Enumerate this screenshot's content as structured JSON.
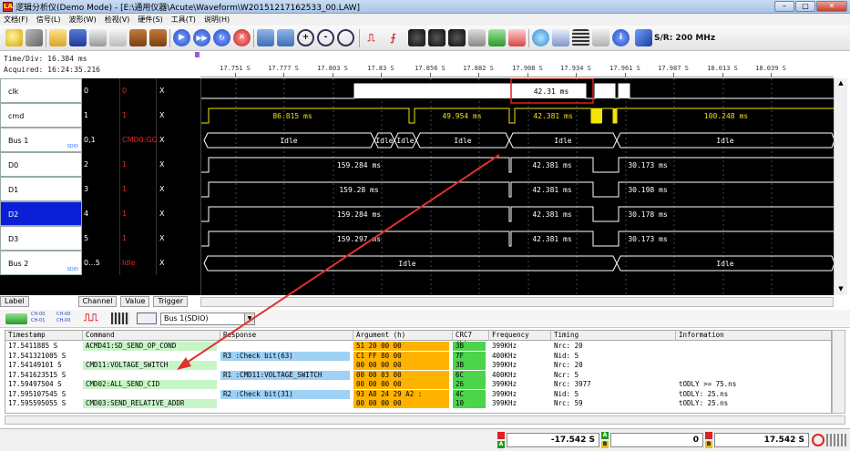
{
  "window": {
    "title": "逻辑分析仪(Demo Mode) - [E:\\通用仪器\\Acute\\Waveform\\W20151217162533_00.LAW]",
    "icon_label": "LA"
  },
  "menu": [
    "文档(F)",
    "信号(L)",
    "波形(W)",
    "检视(V)",
    "硬件(S)",
    "工具(T)",
    "说明(H)"
  ],
  "toolbar": {
    "sample_rate": "S/R: 200 MHz"
  },
  "info": {
    "time_div": "Time/Div: 16.384 ms",
    "acquired": "Acquired: 16:24:35.216"
  },
  "ruler": {
    "ticks": [
      "17.751 S",
      "17.777 S",
      "17.803 S",
      "17.83 S",
      "17.856 S",
      "17.882 S",
      "17.908 S",
      "17.934 S",
      "17.961 S",
      "17.987 S",
      "18.013 S",
      "18.039 S"
    ]
  },
  "signals": [
    {
      "name": "clk",
      "channel": "0",
      "value": "0",
      "trigger": "X",
      "sub": ""
    },
    {
      "name": "cmd",
      "channel": "1",
      "value": "1",
      "trigger": "X",
      "sub": ""
    },
    {
      "name": "Bus 1",
      "channel": "0,1",
      "value": "CMD0:GO",
      "trigger": "X",
      "sub": "SDIO"
    },
    {
      "name": "D0",
      "channel": "2",
      "value": "1",
      "trigger": "X",
      "sub": ""
    },
    {
      "name": "D1",
      "channel": "3",
      "value": "1",
      "trigger": "X",
      "sub": ""
    },
    {
      "name": "D2",
      "channel": "4",
      "value": "1",
      "trigger": "X",
      "sub": ""
    },
    {
      "name": "D3",
      "channel": "5",
      "value": "1",
      "trigger": "X",
      "sub": ""
    },
    {
      "name": "Bus 2",
      "channel": "0...5",
      "value": "Idle",
      "trigger": "X",
      "sub": "SDIO"
    }
  ],
  "wave_labels": {
    "clk": [
      "42.31 ms"
    ],
    "cmd": [
      "86.815 ms",
      "49.954 ms",
      "42.381 ms",
      "100.248 ms"
    ],
    "bus1": [
      "Idle",
      "Idle",
      "Idle",
      "Idle",
      "Idle",
      "Idle"
    ],
    "d0": [
      "159.284 ms",
      "42.381 ms",
      "30.173 ms"
    ],
    "d1": [
      "159.28 ms",
      "42.381 ms",
      "30.198 ms"
    ],
    "d2": [
      "159.284 ms",
      "42.381 ms",
      "30.178 ms"
    ],
    "d3": [
      "159.297 ms",
      "42.381 ms",
      "30.173 ms"
    ],
    "bus2": [
      "Idle",
      "Idle"
    ]
  },
  "tabs": [
    "Label",
    "Channel",
    "Value",
    "Trigger"
  ],
  "protocol": {
    "bus_select": "Bus 1(SDIO)",
    "ch_labels": [
      "CH-00",
      "CH-01",
      "CH-00",
      "CH-00"
    ]
  },
  "table": {
    "headers": [
      "Timestamp",
      "Command",
      "Response",
      "Argument (h)",
      "CRC7 (h)",
      "Frequency",
      "Timing",
      "Information"
    ],
    "rows": [
      [
        "17.5411885 S",
        "ACMD41:SD_SEND_OP_COND",
        "",
        "51 20 00 00",
        "3B",
        "399KHz",
        "Nrc: 20",
        ""
      ],
      [
        "17.541321005 S",
        "",
        "R3 :Check bit(63)",
        "C1 FF 80 00",
        "7F",
        "400KHz",
        "Nid: 5",
        ""
      ],
      [
        "17.54149101 S",
        "CMD11:VOLTAGE_SWITCH",
        "",
        "00 00 00 00",
        "3B",
        "399KHz",
        "Nrc: 20",
        ""
      ],
      [
        "17.541623515 S",
        "",
        "R1 :CMD11:VOLTAGE_SWITCH",
        "00 00 03 00",
        "6C",
        "400KHz",
        "Ncr: 5",
        ""
      ],
      [
        "17.59497504 S",
        "CMD02:ALL_SEND_CID",
        "",
        "00 00 00 00",
        "26",
        "399KHz",
        "Nrc: 3977",
        "tODLY >= 75.ns"
      ],
      [
        "17.595107545 S",
        "",
        "R2 :Check bit(31)",
        "93 A8 24 29 A2 :",
        "4C",
        "399KHz",
        "Nid: 5",
        "tODLY: 25.ns"
      ],
      [
        "17.595595055 S",
        "CMD03:SEND_RELATIVE_ADDR",
        "",
        "00 00 00 00",
        "10",
        "399KHz",
        "Nrc: 59",
        "tODLY: 25.ns"
      ]
    ]
  },
  "status": {
    "cursor_a": "-17.542 S",
    "cursor_zero": "0",
    "cursor_b": "17.542 S",
    "mark_a": "A",
    "mark_b": "B"
  },
  "colors": {
    "wave_white": "#ffffff",
    "wave_yellow": "#f5e400",
    "highlight_red": "#e02020",
    "arrow_red": "#e03030",
    "cmd_green": "#c8f5c8",
    "resp_blue": "#9fd0f5",
    "arg_orange": "#ffb300",
    "crc_green": "#4cd44c"
  }
}
